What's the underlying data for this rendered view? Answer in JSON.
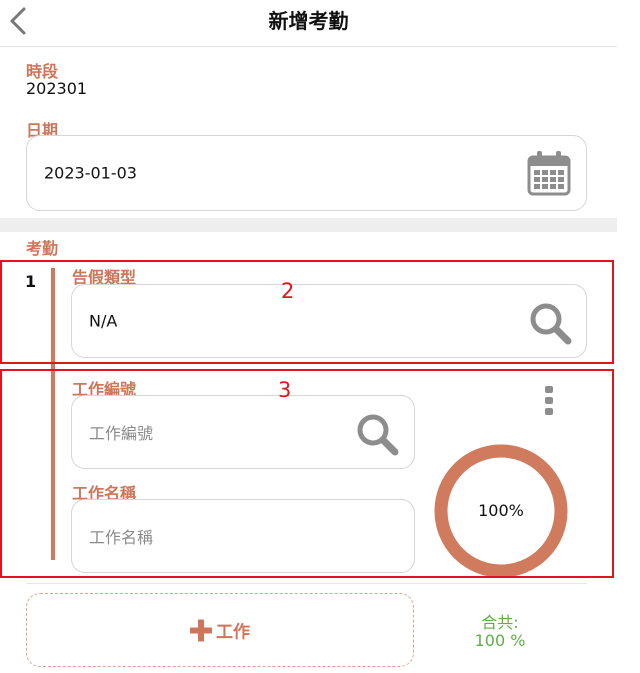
{
  "header": {
    "title": "新增考勤"
  },
  "period": {
    "label": "時段",
    "value": "202301"
  },
  "date": {
    "label": "日期",
    "value": "2023-01-03"
  },
  "attendance": {
    "label": "考勤",
    "index": "1",
    "leave_type": {
      "label": "告假類型",
      "value": "N/A"
    },
    "job_no": {
      "label": "工作編號",
      "placeholder": "工作編號"
    },
    "job_name": {
      "label": "工作名稱",
      "placeholder": "工作名稱"
    },
    "percent": {
      "text": "100%",
      "value": 100
    }
  },
  "annotations": {
    "box2": "2",
    "box3": "3"
  },
  "actions": {
    "add_job": "工作"
  },
  "total": {
    "label": "合共:",
    "value": "100 %"
  },
  "colors": {
    "accent": "#cf7559",
    "ring": "#d07a5e",
    "total": "#5fae48",
    "annotation": "#e4141b"
  },
  "icons": [
    "back-icon",
    "calendar-icon",
    "search-icon",
    "more-vertical-icon",
    "plus-icon"
  ]
}
